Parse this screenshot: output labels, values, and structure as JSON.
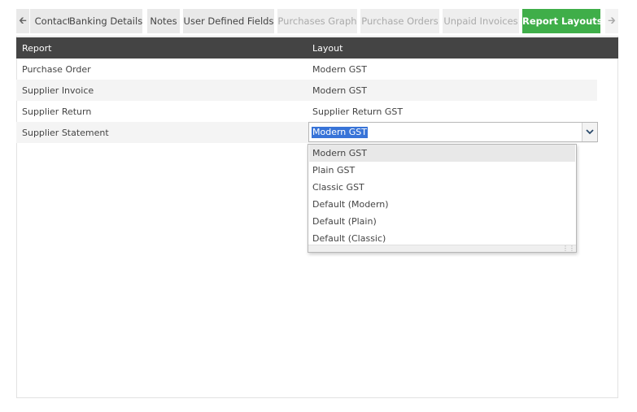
{
  "tabs": [
    {
      "label": "Contacts",
      "state": "normal"
    },
    {
      "label": "Banking Details",
      "state": "normal"
    },
    {
      "label": "Notes",
      "state": "normal"
    },
    {
      "label": "User Defined Fields",
      "state": "normal"
    },
    {
      "label": "Purchases Graph",
      "state": "disabled"
    },
    {
      "label": "Purchase Orders",
      "state": "disabled"
    },
    {
      "label": "Unpaid Invoices",
      "state": "disabled"
    },
    {
      "label": "Report Layouts",
      "state": "active"
    }
  ],
  "table": {
    "headers": {
      "report": "Report",
      "layout": "Layout"
    },
    "rows": [
      {
        "report": "Purchase Order",
        "layout": "Modern GST"
      },
      {
        "report": "Supplier Invoice",
        "layout": "Modern GST"
      },
      {
        "report": "Supplier Return",
        "layout": "Supplier Return GST"
      },
      {
        "report": "Supplier Statement",
        "layout": "Modern GST"
      }
    ]
  },
  "dropdown": {
    "selected": "Modern GST",
    "options": [
      "Modern GST",
      "Plain GST",
      "Classic GST",
      "Default (Modern)",
      "Default (Plain)",
      "Default (Classic)"
    ]
  },
  "colors": {
    "active_tab": "#3fae49",
    "header_bg": "#444444",
    "selection": "#3874d8"
  }
}
